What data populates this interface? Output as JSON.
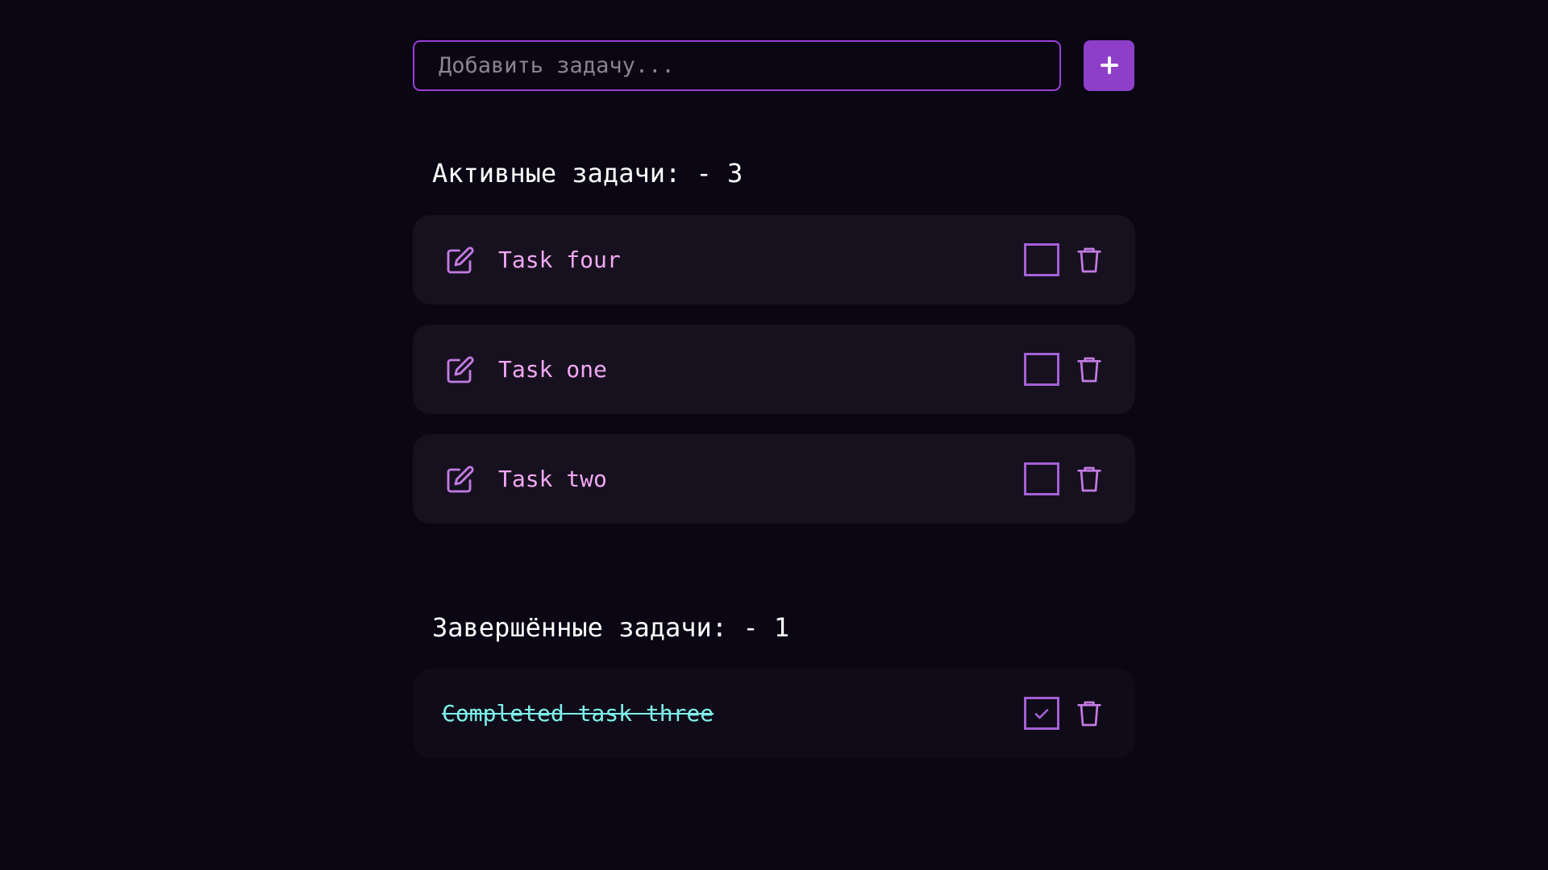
{
  "input": {
    "placeholder": "Добавить задачу...",
    "value": ""
  },
  "add_button": {
    "icon": "plus-icon"
  },
  "active_section": {
    "title": "Активные задачи: - 3",
    "tasks": [
      {
        "text": "Task four",
        "completed": false
      },
      {
        "text": "Task one",
        "completed": false
      },
      {
        "text": "Task two",
        "completed": false
      }
    ]
  },
  "completed_section": {
    "title": "Завершённые задачи: - 1",
    "tasks": [
      {
        "text": "Completed task three",
        "completed": true
      }
    ]
  },
  "icons": {
    "edit": "pencil-square-icon",
    "delete": "trash-icon",
    "checkbox_empty": "checkbox-empty-icon",
    "checkbox_checked": "checkbox-checked-icon"
  },
  "colors": {
    "background": "#0b0614",
    "accent": "#8e3fc9",
    "input_border": "#9a3fd6",
    "card_background": "#17111f",
    "active_task_text": "#f2a8f4",
    "completed_task_text": "#7ef0ea",
    "icon": "#a461d6",
    "heading": "#ffffff"
  }
}
